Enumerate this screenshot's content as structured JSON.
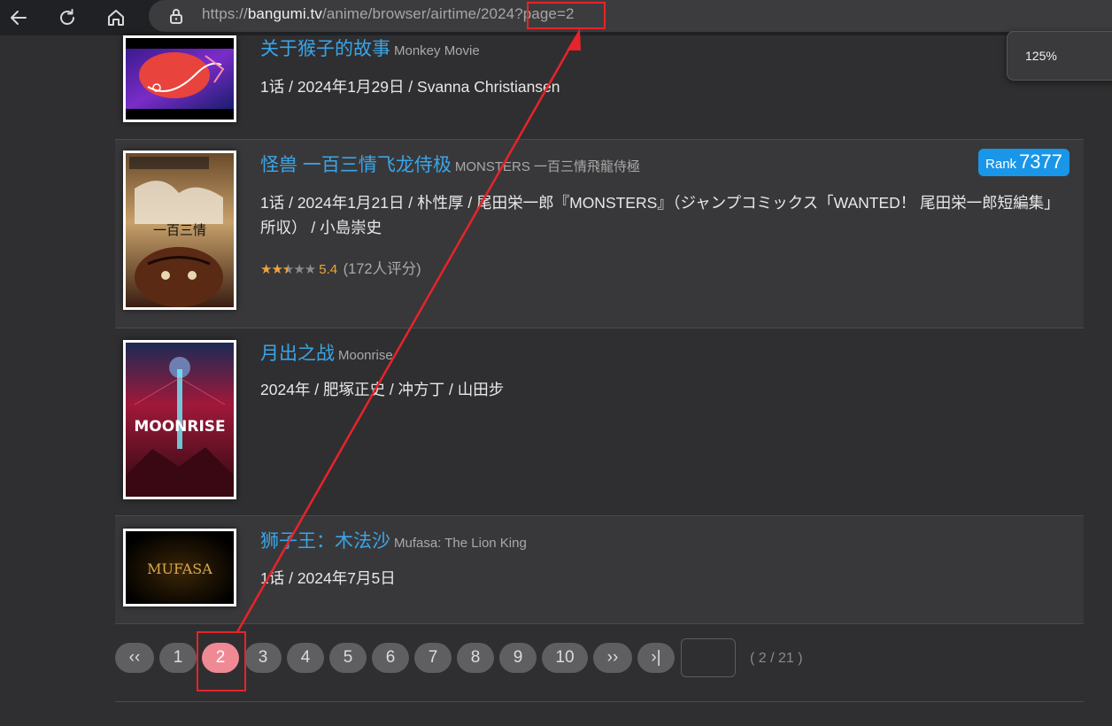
{
  "browser": {
    "url_prefix": "https://",
    "url_host": "bangumi.tv",
    "url_path": "/anime/browser/airtime/2024",
    "url_query": "?page=2",
    "zoom_level": "125%",
    "icons": [
      "back-icon",
      "reload-icon",
      "home-icon",
      "lock-icon"
    ]
  },
  "items": [
    {
      "title_cn": "关于猴子的故事",
      "title_orig": "Monkey Movie",
      "info": "1话 / 2024年1月29日 / Svanna Christiansen"
    },
    {
      "title_cn": "怪兽 一百三情飞龙侍极",
      "title_orig": "MONSTERS 一百三情飛龍侍極",
      "info": "1话 / 2024年1月21日 / 朴性厚 / 尾田栄一郎『MONSTERS』（ジャンプコミックス「WANTED！ 尾田栄一郎短編集」所収） / 小島崇史",
      "rank_label": "Rank",
      "rank": "7377",
      "stars": 2.5,
      "score": "5.4",
      "votes": "(172人评分)"
    },
    {
      "title_cn": "月出之战",
      "title_orig": "Moonrise",
      "info": "2024年 / 肥塚正史 / 冲方丁 / 山田步"
    },
    {
      "title_cn": "狮子王：木法沙",
      "title_orig": "Mufasa: The Lion King",
      "info": "1话 / 2024年7月5日"
    }
  ],
  "covers": [
    "MOONRISE",
    "MUFASA"
  ],
  "pager": {
    "first": "‹‹",
    "pages": [
      "1",
      "2",
      "3",
      "4",
      "5",
      "6",
      "7",
      "8",
      "9",
      "10"
    ],
    "current": "2",
    "next": "››",
    "last": "›|",
    "count": "( 2 / 21 )"
  },
  "colors": {
    "link": "#3aa5e9",
    "rank_badge": "#1996e8",
    "active_page": "#ef8a94",
    "annotation": "#e8232a",
    "star": "#f0a43a"
  }
}
